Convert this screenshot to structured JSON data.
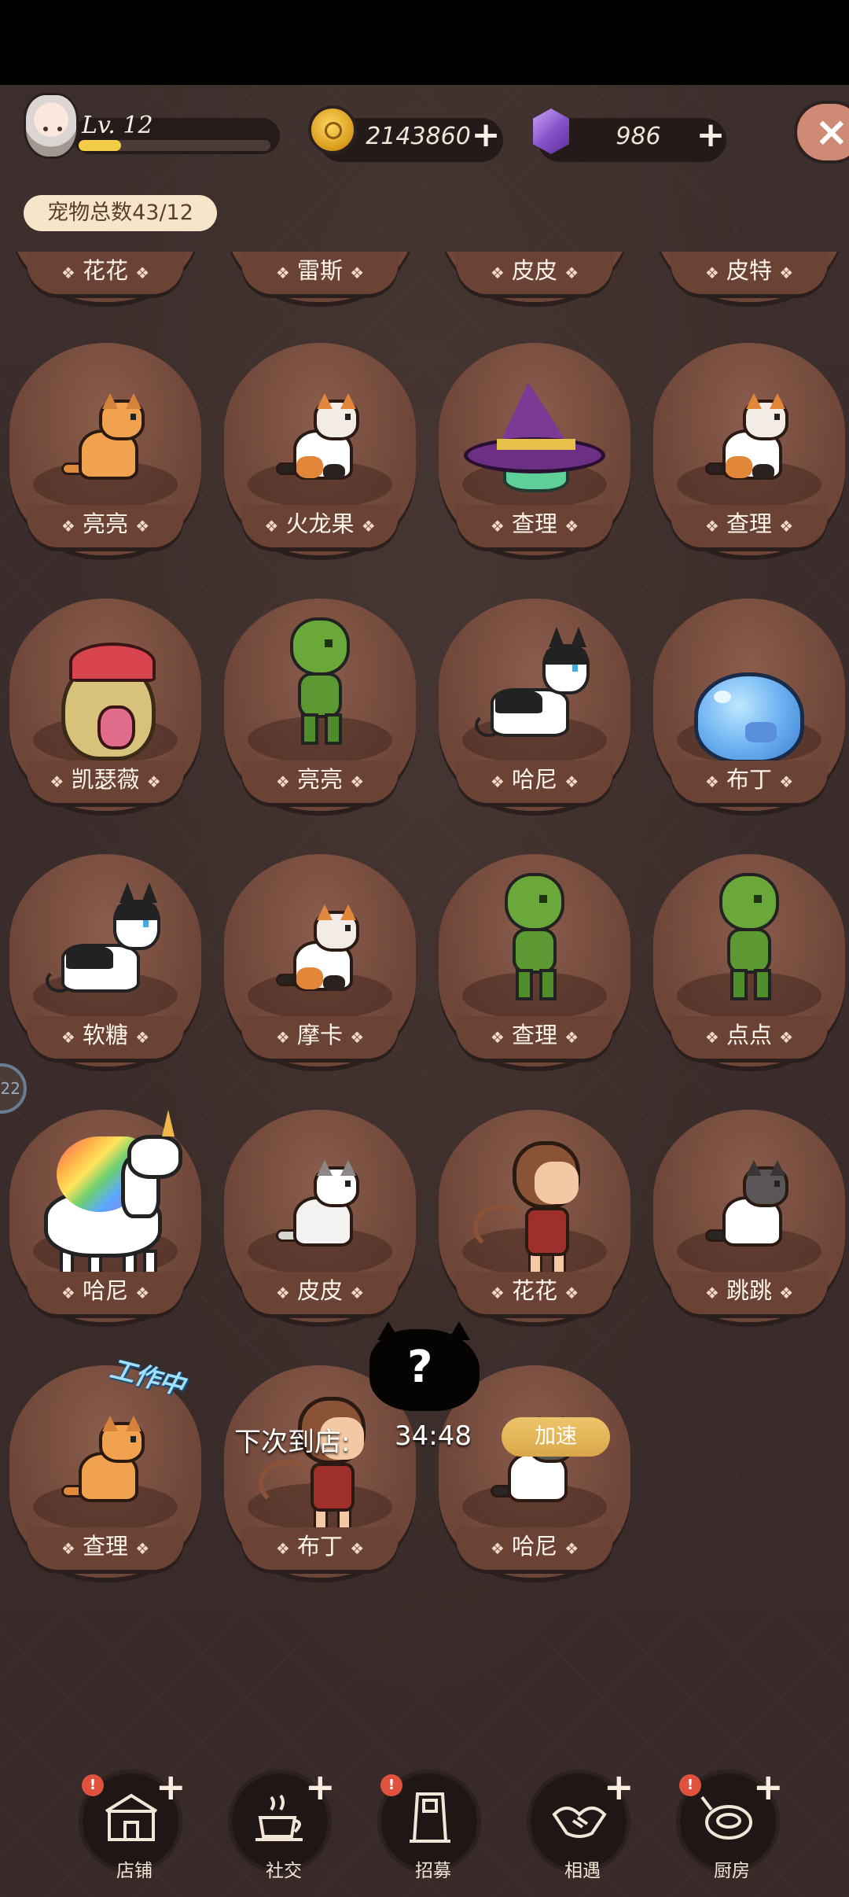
{
  "hud": {
    "level": "Lv. 12",
    "level_progress": 0.22,
    "coins": "2143860",
    "gems": "986",
    "pet_total": "宠物总数43/12"
  },
  "pets_top_row": [
    "花花",
    "雷斯",
    "皮皮",
    "皮特"
  ],
  "pets": [
    {
      "name": "亮亮",
      "sprite": "orange-cat-sprite"
    },
    {
      "name": "火龙果",
      "sprite": "calico-cat-sprite"
    },
    {
      "name": "查理",
      "sprite": "wizard-hat-ghost-sprite"
    },
    {
      "name": "查理",
      "sprite": "calico-cat-sprite"
    },
    {
      "name": "凯瑟薇",
      "sprite": "spartan-helmet-sprite"
    },
    {
      "name": "亮亮",
      "sprite": "green-goblin-sprite"
    },
    {
      "name": "哈尼",
      "sprite": "husky-dog-sprite"
    },
    {
      "name": "布丁",
      "sprite": "blue-slime-sprite"
    },
    {
      "name": "软糖",
      "sprite": "husky-dog-sprite"
    },
    {
      "name": "摩卡",
      "sprite": "calico-cat-sprite"
    },
    {
      "name": "查理",
      "sprite": "green-goblin-sprite"
    },
    {
      "name": "点点",
      "sprite": "green-goblin-sprite"
    },
    {
      "name": "哈尼",
      "sprite": "rainbow-unicorn-sprite"
    },
    {
      "name": "皮皮",
      "sprite": "white-cat-sprite"
    },
    {
      "name": "花花",
      "sprite": "monkey-sprite"
    },
    {
      "name": "跳跳",
      "sprite": "tuxedo-cat-sprite"
    },
    {
      "name": "查理",
      "sprite": "orange-cat-sprite"
    },
    {
      "name": "布丁",
      "sprite": "monkey-sprite"
    },
    {
      "name": "哈尼",
      "sprite": "tuxedo-cat-sprite"
    }
  ],
  "status": {
    "working": "工作中",
    "mystery_mark": "?",
    "next_arrival_label": "下次到店:",
    "next_arrival_time": "34:48",
    "speed_up": "加速"
  },
  "side_handle": "22",
  "nav": [
    {
      "label": "店铺",
      "icon": "shop-icon",
      "alert": true,
      "plus": true
    },
    {
      "label": "社交",
      "icon": "coffee-cup-icon",
      "alert": false,
      "plus": true
    },
    {
      "label": "招募",
      "icon": "recruit-door-icon",
      "alert": true,
      "plus": false
    },
    {
      "label": "相遇",
      "icon": "handshake-icon",
      "alert": false,
      "plus": true
    },
    {
      "label": "厨房",
      "icon": "frying-pan-icon",
      "alert": true,
      "plus": true
    }
  ],
  "colors": {
    "background": "#3a2c2a",
    "card": "#6e4638",
    "accent_gold": "#f2cd45",
    "speed_button": "#e5b95d"
  }
}
